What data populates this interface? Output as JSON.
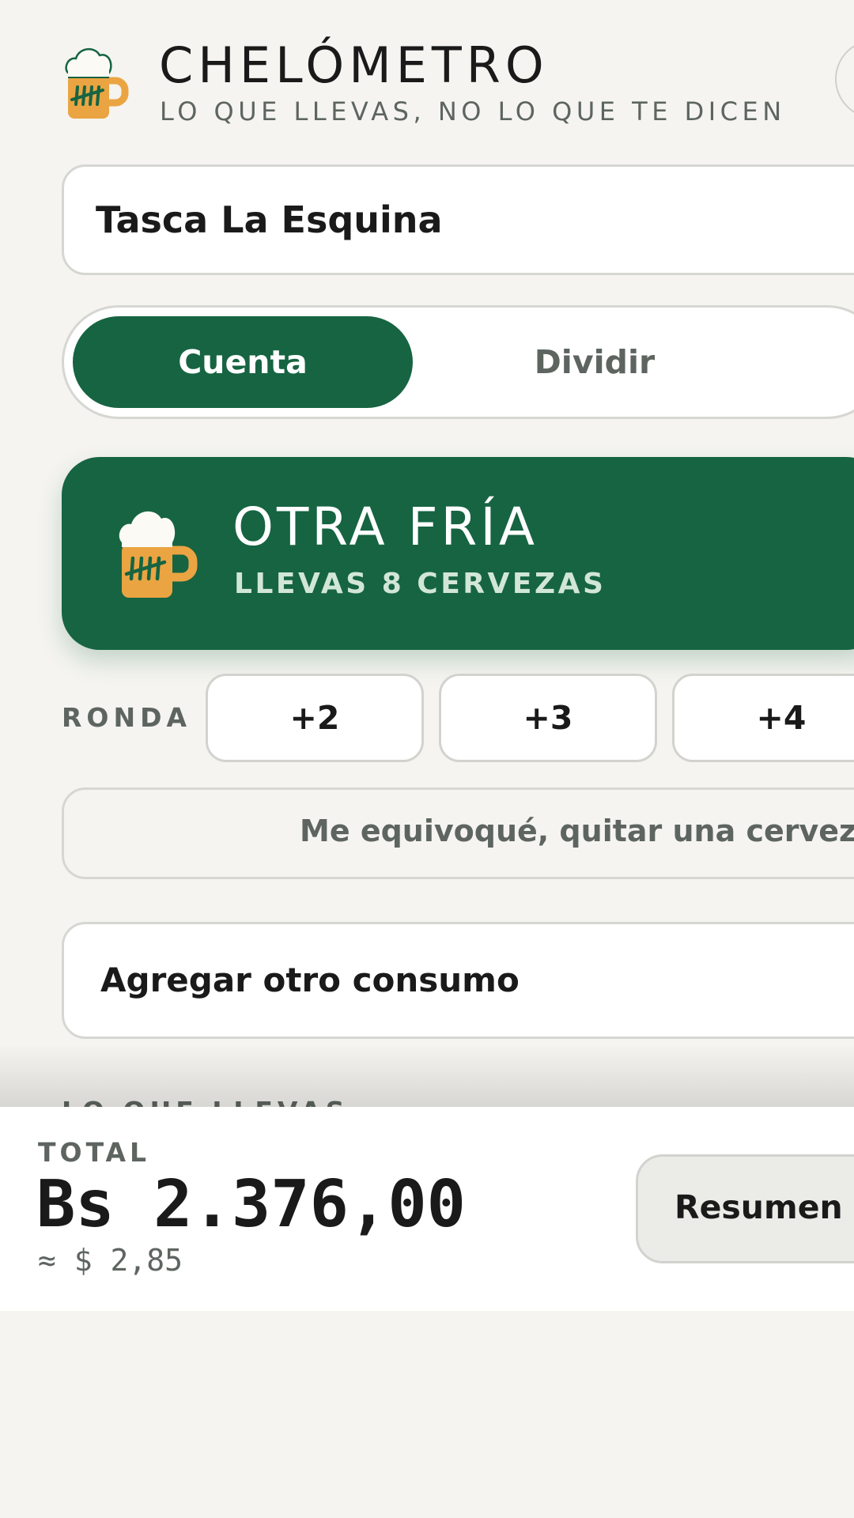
{
  "header": {
    "title": "CHELÓMETRO",
    "subtitle": "LO QUE LLEVAS, NO LO QUE TE DICEN",
    "logo_icon": "beer-mug-icon"
  },
  "venue": {
    "value": "Tasca La Esquina"
  },
  "tabs": [
    {
      "label": "Cuenta",
      "active": true
    },
    {
      "label": "Dividir",
      "active": false
    }
  ],
  "beer_button": {
    "title": "OTRA FRÍA",
    "count_text": "LLEVAS 8 CERVEZAS",
    "icon": "beer-mug-icon"
  },
  "ronda": {
    "label": "RONDA",
    "options": [
      "+2",
      "+3",
      "+4"
    ]
  },
  "undo_label": "Me equivoqué, quitar una cervez",
  "add_label": "Agregar otro consumo",
  "section_heading": "LO QUE LLEVAS",
  "footer": {
    "total_label": "TOTAL",
    "total_amount": "Bs 2.376,00",
    "total_usd": "≈ $ 2,85",
    "summary_label": "Resumen"
  },
  "colors": {
    "accent": "#166442",
    "mug": "#eba442",
    "foam": "#fbfaf5",
    "background": "#f5f4f0",
    "muted_text": "#5e6560"
  }
}
